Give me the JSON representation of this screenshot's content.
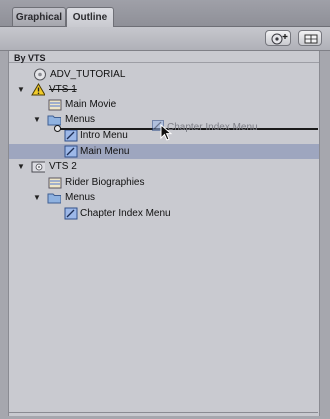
{
  "tabs": [
    {
      "label": "Graphical",
      "active": false
    },
    {
      "label": "Outline",
      "active": true
    }
  ],
  "toolbar": {
    "add_icon": "disc-add-icon",
    "view_icon": "view-toggle-icon"
  },
  "panel": {
    "header": "By VTS"
  },
  "tree": {
    "adv_tutorial": "ADV_TUTORIAL",
    "vts1": "VTS 1",
    "main_movie": "Main Movie",
    "vts1_menus": "Menus",
    "intro_menu": "Intro Menu",
    "main_menu": "Main Menu",
    "vts2": "VTS 2",
    "rider_biographies": "Rider Biographies",
    "vts2_menus": "Menus",
    "chapter_index_menu": "Chapter Index Menu"
  },
  "drag": {
    "ghost_label": "Chapter Index Menu"
  },
  "colors": {
    "selection": "#9ea6bf",
    "panel_bg": "#c9cad0",
    "warning": "#e8c020"
  }
}
